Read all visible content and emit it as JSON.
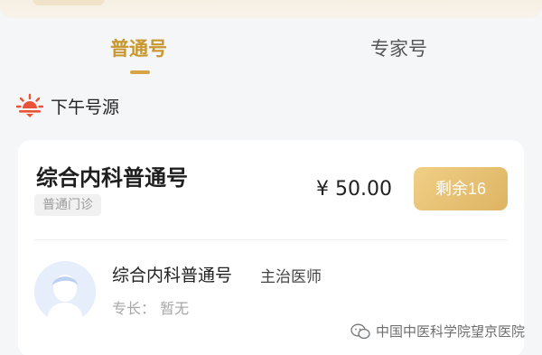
{
  "tabs": [
    {
      "label": "普通号",
      "active": true
    },
    {
      "label": "专家号",
      "active": false
    }
  ],
  "section": {
    "title": "下午号源",
    "icon": "sunset-icon"
  },
  "card": {
    "dept_name": "综合内科普通号",
    "tag": "普通门诊",
    "price": "¥ 50.00",
    "remaining": "剩余16",
    "doctor": {
      "name": "综合内科普通号",
      "title": "主治医师",
      "specialty": "专长：  暂无"
    }
  },
  "watermark": {
    "text": "中国中医科学院望京医院",
    "icon": "wechat-icon"
  },
  "colors": {
    "accent": "#c8972e",
    "button_gradient_start": "#f0cf86",
    "button_gradient_end": "#deb463",
    "icon_red": "#e8533a"
  }
}
